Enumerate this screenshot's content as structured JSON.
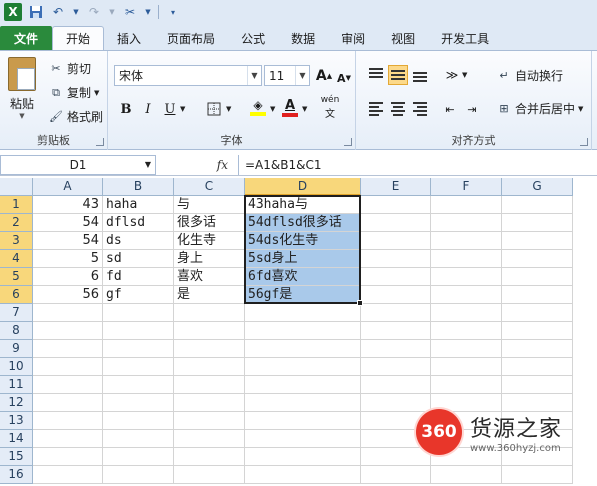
{
  "qat": {
    "app_label": "X",
    "icons": [
      "save-icon",
      "undo-icon",
      "redo-icon",
      "customize-icon"
    ]
  },
  "tabs": [
    "文件",
    "开始",
    "插入",
    "页面布局",
    "公式",
    "数据",
    "审阅",
    "视图",
    "开发工具"
  ],
  "active_tab": "开始",
  "ribbon": {
    "clipboard": {
      "paste": "粘贴",
      "cut": "剪切",
      "copy": "复制",
      "format_painter": "格式刷",
      "label": "剪贴板"
    },
    "font": {
      "name": "宋体",
      "size": "11",
      "label": "字体",
      "bold": "B",
      "italic": "I",
      "underline": "U",
      "grow": "A",
      "shrink": "A",
      "font_color": "A",
      "phonetic": "wén"
    },
    "alignment": {
      "wrap_text": "自动换行",
      "merge_center": "合并后居中",
      "label": "对齐方式"
    }
  },
  "formula_bar": {
    "name_box": "D1",
    "fx": "fx",
    "formula": "=A1&B1&C1"
  },
  "sheet": {
    "columns": [
      "A",
      "B",
      "C",
      "D",
      "E",
      "F",
      "G"
    ],
    "selected_column": "D",
    "rows": [
      "1",
      "2",
      "3",
      "4",
      "5",
      "6",
      "7",
      "8",
      "9",
      "10",
      "11",
      "12",
      "13",
      "14",
      "15",
      "16"
    ],
    "data": [
      {
        "a": "43",
        "b": "haha",
        "c": "与",
        "d": "43haha与"
      },
      {
        "a": "54",
        "b": "dflsd",
        "c": "很多话",
        "d": "54dflsd很多话"
      },
      {
        "a": "54",
        "b": "ds",
        "c": "化生寺",
        "d": "54ds化生寺"
      },
      {
        "a": "5",
        "b": "sd",
        "c": "身上",
        "d": "5sd身上"
      },
      {
        "a": "6",
        "b": "fd",
        "c": "喜欢",
        "d": "6fd喜欢"
      },
      {
        "a": "56",
        "b": "gf",
        "c": "是",
        "d": "56gf是"
      }
    ]
  },
  "watermark": {
    "logo": "360",
    "title": "货源之家",
    "url": "www.360hyzj.com"
  },
  "colors": {
    "file_tab": "#2a8a3c",
    "selection_fill": "#a9c9ea",
    "header_selected": "#f8d77b",
    "ribbon_bg": "#dfe9f5"
  }
}
